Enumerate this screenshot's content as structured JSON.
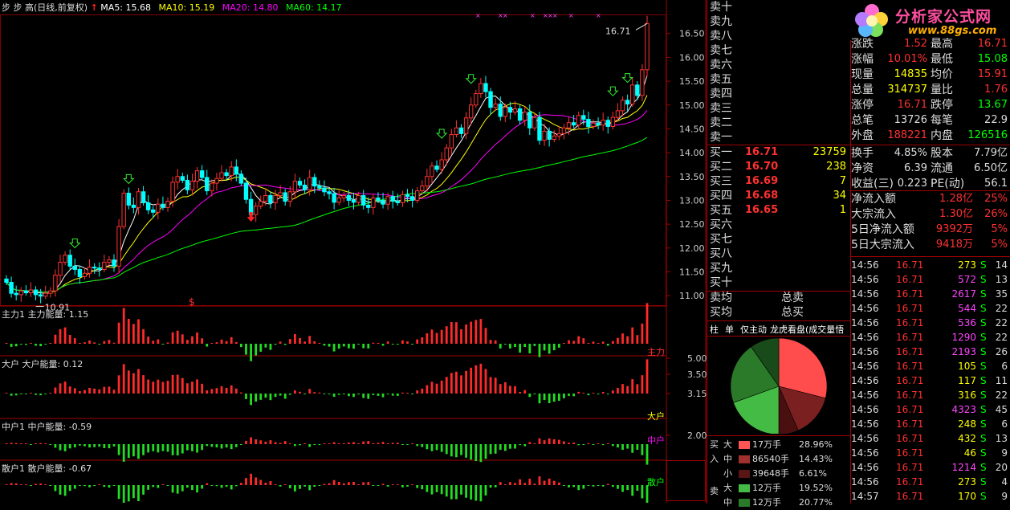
{
  "header": {
    "prefix": "步 步 高(日线,前复权)",
    "ma": [
      {
        "label": "MA5: 15.68",
        "color": "#ffffff"
      },
      {
        "label": "MA10: 15.19",
        "color": "#ffff00"
      },
      {
        "label": "MA20: 14.80",
        "color": "#ff00ff"
      },
      {
        "label": "MA60: 14.17",
        "color": "#00ff00"
      }
    ]
  },
  "chart_data": [
    {
      "type": "candlestick",
      "title": "步 步 高(日线,前复权)",
      "ylim": [
        10.8,
        16.9
      ],
      "yticks": [
        "16.50",
        "16.00",
        "15.50",
        "15.00",
        "14.50",
        "14.00",
        "13.50",
        "13.00",
        "12.50",
        "12.00",
        "11.50",
        "11.00"
      ],
      "annotations": [
        "16.71",
        "10.91",
        "$"
      ],
      "series": [
        {
          "name": "MA5: 15.68"
        },
        {
          "name": "MA10: 15.19"
        },
        {
          "name": "MA20: 14.80"
        },
        {
          "name": "MA60: 14.17"
        }
      ],
      "close": [
        11.28,
        11.05,
        11.02,
        11.1,
        11.06,
        11.12,
        11.02,
        10.99,
        11.05,
        11.1,
        11.43,
        11.7,
        11.85,
        11.62,
        11.55,
        11.4,
        11.47,
        11.6,
        11.58,
        11.55,
        11.7,
        11.75,
        11.62,
        12.45,
        13.15,
        12.9,
        12.85,
        13.18,
        12.95,
        12.8,
        12.75,
        12.92,
        12.85,
        12.98,
        13.38,
        13.5,
        13.42,
        13.22,
        13.4,
        13.62,
        13.48,
        13.2,
        13.36,
        13.46,
        13.58,
        13.52,
        13.7,
        13.55,
        13.36,
        13.02,
        12.7,
        12.88,
        12.98,
        13.1,
        12.95,
        13.1,
        13.16,
        12.98,
        13.18,
        13.4,
        13.32,
        13.22,
        13.48,
        13.3,
        13.26,
        13.18,
        13.14,
        12.96,
        13.05,
        13.1,
        13.0,
        12.96,
        13.1,
        12.9,
        12.85,
        13.05,
        13.0,
        12.92,
        13.08,
        12.98,
        12.95,
        13.12,
        13.08,
        13.0,
        13.2,
        13.3,
        13.5,
        13.72,
        13.65,
        13.85,
        14.1,
        14.38,
        14.52,
        14.4,
        14.73,
        15.0,
        15.24,
        15.45,
        15.28,
        14.95,
        15.02,
        14.76,
        14.95,
        14.85,
        14.92,
        14.68,
        14.85,
        14.52,
        14.74,
        14.26,
        14.45,
        14.28,
        14.35,
        14.4,
        14.52,
        14.63,
        14.58,
        14.78,
        14.7,
        14.55,
        14.62,
        14.58,
        14.68,
        14.55,
        14.74,
        14.88,
        15.1,
        15.02,
        15.42,
        15.2,
        15.74,
        16.71
      ],
      "volume": [
        0.35,
        0.36,
        0.38,
        0.4,
        0.42,
        0.44,
        0.42,
        0.4,
        0.36,
        0.34,
        0.42,
        0.55,
        0.58,
        0.5,
        0.46,
        0.48,
        0.52,
        0.58,
        0.56,
        0.52,
        0.5,
        0.48,
        0.46,
        0.62,
        0.78,
        0.72,
        0.66,
        0.6,
        0.58,
        0.56,
        0.58,
        0.6,
        0.62,
        0.66,
        0.72,
        0.75,
        0.7,
        0.66,
        0.64,
        0.68,
        0.66,
        0.6,
        0.58,
        0.56,
        0.6,
        0.62,
        0.66,
        0.6,
        0.55,
        0.52,
        0.5,
        0.5,
        0.52,
        0.54,
        0.52,
        0.54,
        0.56,
        0.54,
        0.56,
        0.6,
        0.58,
        0.56,
        0.58,
        0.56,
        0.54,
        0.52,
        0.5,
        0.48,
        0.5,
        0.52,
        0.5,
        0.48,
        0.5,
        0.48,
        0.46,
        0.48,
        0.5,
        0.48,
        0.5,
        0.48,
        0.47,
        0.5,
        0.52,
        0.55,
        0.58,
        0.62,
        0.66,
        0.7,
        0.72,
        0.75,
        0.78,
        0.8,
        0.82,
        0.8,
        0.82,
        0.85,
        0.88,
        0.9,
        0.88,
        0.84,
        0.82,
        0.78,
        0.76,
        0.74,
        0.72,
        0.7,
        0.7,
        0.68,
        0.66,
        0.64,
        0.62,
        0.62,
        0.64,
        0.66,
        0.66,
        0.68,
        0.68,
        0.7,
        0.7,
        0.68,
        0.68,
        0.68,
        0.7,
        0.7,
        0.72,
        0.74,
        0.78,
        0.78,
        0.82,
        0.84,
        0.9,
        1.0
      ]
    },
    {
      "type": "bar",
      "title": "主力1 主力能量: 1.15",
      "yticks": [
        "5.00"
      ],
      "label": "主力"
    },
    {
      "type": "bar",
      "title": "大户 大户能量: 0.12",
      "yticks": [
        "3.50",
        "3.15"
      ],
      "label": "大户"
    },
    {
      "type": "bar",
      "title": "中户1 中户能量: -0.59",
      "yticks": [
        "2.00"
      ],
      "label": "中户"
    },
    {
      "type": "bar",
      "title": "散户1 散户能量: -0.67",
      "label": "散户"
    },
    {
      "type": "pie",
      "categories": [
        "买大",
        "买中",
        "买小",
        "卖大",
        "卖中",
        "卖小"
      ],
      "values": [
        28.96,
        14.43,
        6.61,
        19.52,
        20.77,
        9.71
      ]
    }
  ],
  "orderbook": {
    "sells": [
      "卖十",
      "卖九",
      "卖八",
      "卖七",
      "卖六",
      "卖五",
      "卖四",
      "卖三",
      "卖二",
      "卖一"
    ],
    "buys": [
      {
        "label": "买一",
        "price": "16.71",
        "vol": "23759"
      },
      {
        "label": "买二",
        "price": "16.70",
        "vol": "238"
      },
      {
        "label": "买三",
        "price": "16.69",
        "vol": "7"
      },
      {
        "label": "买四",
        "price": "16.68",
        "vol": "34"
      },
      {
        "label": "买五",
        "price": "16.65",
        "vol": "1"
      },
      {
        "label": "买六",
        "price": "",
        "vol": ""
      },
      {
        "label": "买七",
        "price": "",
        "vol": ""
      },
      {
        "label": "买八",
        "price": "",
        "vol": ""
      },
      {
        "label": "买九",
        "price": "",
        "vol": ""
      },
      {
        "label": "买十",
        "price": "",
        "vol": ""
      }
    ],
    "avg_sell": "卖均",
    "total_sell": "总卖",
    "avg_buy": "买均",
    "total_buy": "总买"
  },
  "tabs": [
    "柱",
    "单",
    "仅主动",
    "龙虎看盘(成交量悟"
  ],
  "flow_legend": {
    "side_buy": "买入",
    "side_sell": "卖",
    "rows": [
      {
        "size": "大",
        "lots": "17万手",
        "pct": "28.96%",
        "color": "#ff5555"
      },
      {
        "size": "中",
        "lots": "86540手",
        "pct": "14.43%",
        "color": "#a03030"
      },
      {
        "size": "小",
        "lots": "39648手",
        "pct": "6.61%",
        "color": "#5a1515"
      },
      {
        "size": "大",
        "lots": "12万手",
        "pct": "19.52%",
        "color": "#44bb44"
      },
      {
        "size": "中",
        "lots": "12万手",
        "pct": "20.77%",
        "color": "#2a7a2a"
      }
    ]
  },
  "logo": {
    "brand": "分析家公式网",
    "url": "www.88gs.com"
  },
  "quote": [
    {
      "l": "涨跌",
      "v": "1.52",
      "l2": "最高",
      "v2": "16.71"
    },
    {
      "l": "涨幅",
      "v": "10.01%",
      "l2": "最低",
      "v2": "15.08"
    },
    {
      "l": "现量",
      "v": "14835",
      "l2": "均价",
      "v2": "15.91"
    },
    {
      "l": "总量",
      "v": "314737",
      "l2": "量比",
      "v2": "1.76"
    },
    {
      "l": "涨停",
      "v": "16.71",
      "l2": "跌停",
      "v2": "13.67"
    },
    {
      "l": "总笔",
      "v": "13726",
      "l2": "每笔",
      "v2": "22.9"
    },
    {
      "l": "外盘",
      "v": "188221",
      "l2": "内盘",
      "v2": "126516"
    }
  ],
  "fundamentals": [
    {
      "l": "换手",
      "v": "4.85%",
      "l2": "股本",
      "v2": "7.79亿"
    },
    {
      "l": "净资",
      "v": "6.39",
      "l2": "流通",
      "v2": "6.50亿"
    },
    {
      "l": "收益(三)",
      "v": "0.223",
      "l2": "PE(动)",
      "v2": "56.1"
    }
  ],
  "flows": [
    {
      "l": "净流入额",
      "v": "1.28亿",
      "p": "25%"
    },
    {
      "l": "大宗流入",
      "v": "1.30亿",
      "p": "26%"
    },
    {
      "l": "5日净流入额",
      "v": "9392万",
      "p": "5%"
    },
    {
      "l": "5日大宗流入",
      "v": "9418万",
      "p": "5%"
    }
  ],
  "ticks": [
    {
      "t": "14:56",
      "p": "16.71",
      "v": "273",
      "s": "S",
      "n": "14"
    },
    {
      "t": "14:56",
      "p": "16.71",
      "v": "572",
      "s": "S",
      "n": "13"
    },
    {
      "t": "14:56",
      "p": "16.71",
      "v": "2617",
      "s": "S",
      "n": "35"
    },
    {
      "t": "14:56",
      "p": "16.71",
      "v": "544",
      "s": "S",
      "n": "22"
    },
    {
      "t": "14:56",
      "p": "16.71",
      "v": "536",
      "s": "S",
      "n": "22"
    },
    {
      "t": "14:56",
      "p": "16.71",
      "v": "1290",
      "s": "S",
      "n": "22"
    },
    {
      "t": "14:56",
      "p": "16.71",
      "v": "2193",
      "s": "S",
      "n": "26"
    },
    {
      "t": "14:56",
      "p": "16.71",
      "v": "105",
      "s": "S",
      "n": "6"
    },
    {
      "t": "14:56",
      "p": "16.71",
      "v": "117",
      "s": "S",
      "n": "11"
    },
    {
      "t": "14:56",
      "p": "16.71",
      "v": "316",
      "s": "S",
      "n": "22"
    },
    {
      "t": "14:56",
      "p": "16.71",
      "v": "4323",
      "s": "S",
      "n": "45"
    },
    {
      "t": "14:56",
      "p": "16.71",
      "v": "248",
      "s": "S",
      "n": "6"
    },
    {
      "t": "14:56",
      "p": "16.71",
      "v": "432",
      "s": "S",
      "n": "13"
    },
    {
      "t": "14:56",
      "p": "16.71",
      "v": "46",
      "s": "S",
      "n": "9"
    },
    {
      "t": "14:56",
      "p": "16.71",
      "v": "1214",
      "s": "S",
      "n": "20"
    },
    {
      "t": "14:56",
      "p": "16.71",
      "v": "273",
      "s": "S",
      "n": "4"
    },
    {
      "t": "14:57",
      "p": "16.71",
      "v": "170",
      "s": "S",
      "n": "9"
    }
  ]
}
